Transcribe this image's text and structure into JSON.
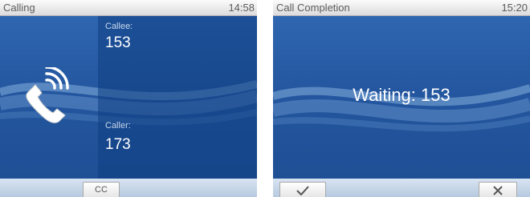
{
  "calling_screen": {
    "title": "Calling",
    "time": "14:58",
    "callee_label": "Callee:",
    "callee_number": "153",
    "caller_label": "Caller:",
    "caller_number": "173",
    "phone_icon": "ringing-handset-icon",
    "softkeys": [
      "CC"
    ]
  },
  "call_completion_screen": {
    "title": "Call Completion",
    "time": "15:20",
    "message": "Waiting: 153",
    "softkeys": [
      {
        "icon": "check-icon"
      },
      {
        "icon": "close-icon"
      }
    ]
  },
  "colors": {
    "background_blue": "#2a5fa7",
    "panel_blue": "#12428a",
    "status_bar": "#e8e8e8",
    "text_white": "#ffffff"
  }
}
